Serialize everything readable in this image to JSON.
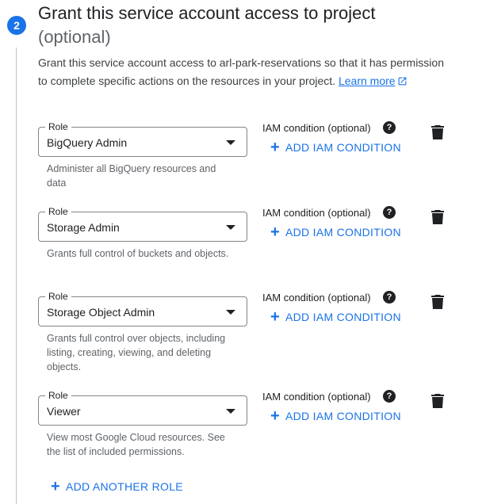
{
  "step": {
    "number": "2",
    "title": "Grant this service account access to project",
    "optional": "(optional)",
    "description": "Grant this service account access to arl-park-reservations so that it has permission to complete specific actions on the resources in your project.",
    "learn_more": "Learn more"
  },
  "roles": [
    {
      "label": "Role",
      "value": "BigQuery Admin",
      "hint": "Administer all BigQuery resources and data",
      "iam_label": "IAM condition (optional)",
      "add_condition": "ADD IAM CONDITION"
    },
    {
      "label": "Role",
      "value": "Storage Admin",
      "hint": "Grants full control of buckets and objects.",
      "iam_label": "IAM condition (optional)",
      "add_condition": "ADD IAM CONDITION"
    },
    {
      "label": "Role",
      "value": "Storage Object Admin",
      "hint": "Grants full control over objects, including listing, creating, viewing, and deleting objects.",
      "iam_label": "IAM condition (optional)",
      "add_condition": "ADD IAM CONDITION"
    },
    {
      "label": "Role",
      "value": "Viewer",
      "hint": "View most Google Cloud resources. See the list of included permissions.",
      "iam_label": "IAM condition (optional)",
      "add_condition": "ADD IAM CONDITION"
    }
  ],
  "add_another_role": "ADD ANOTHER ROLE",
  "icons": {
    "help": "help-icon",
    "delete": "trash-icon",
    "dropdown": "arrow-drop-down-icon",
    "add": "plus-icon",
    "external": "open-in-new-icon"
  },
  "colors": {
    "accent": "#1a73e8",
    "text": "#202124",
    "muted": "#5f6368"
  }
}
